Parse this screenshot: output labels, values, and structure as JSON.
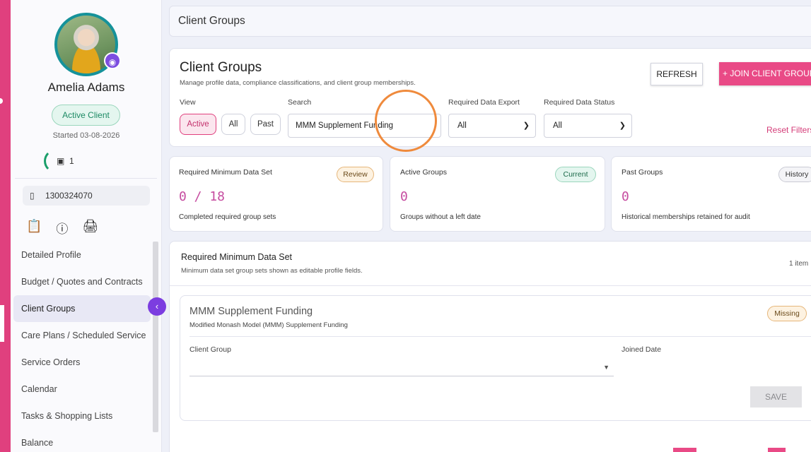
{
  "sidebar": {
    "client_name": "Amelia Adams",
    "status": "Active Client",
    "started": "Started 03-08-2026",
    "count": "1",
    "phone": "1300324070",
    "nav_items": [
      {
        "label": "Detailed Profile"
      },
      {
        "label": "Budget / Quotes and Contracts"
      },
      {
        "label": "Client Groups"
      },
      {
        "label": "Care Plans / Scheduled Service"
      },
      {
        "label": "Service Orders"
      },
      {
        "label": "Calendar"
      },
      {
        "label": "Tasks & Shopping Lists"
      },
      {
        "label": "Balance"
      }
    ],
    "selected_nav": "Client Groups"
  },
  "topbar": {
    "title": "Client Groups"
  },
  "header": {
    "title": "Client Groups",
    "subtitle": "Manage profile data, compliance classifications, and client group memberships.",
    "refresh_label": "REFRESH",
    "join_label": "+ JOIN CLIENT GROUP",
    "reset_label": "Reset Filters"
  },
  "filters": {
    "view_label": "View",
    "view_options": [
      "Active",
      "All",
      "Past"
    ],
    "view_selected": "Active",
    "search_label": "Search",
    "search_value": "MMM Supplement Funding",
    "export_label": "Required Data Export",
    "export_value": "All",
    "status_label": "Required Data Status",
    "status_value": "All"
  },
  "stats": [
    {
      "label": "Required Minimum Data Set",
      "badge": "Review",
      "value": "0 / 18",
      "desc": "Completed required group sets"
    },
    {
      "label": "Active Groups",
      "badge": "Current",
      "value": "0",
      "desc": "Groups without a left date"
    },
    {
      "label": "Past Groups",
      "badge": "History",
      "value": "0",
      "desc": "Historical memberships retained for audit"
    }
  ],
  "section": {
    "title": "Required Minimum Data Set",
    "subtitle": "Minimum data set group sets shown as editable profile fields.",
    "count": "1 item"
  },
  "group_card": {
    "title": "MMM Supplement Funding",
    "subtitle": "Modified Monash Model (MMM) Supplement Funding",
    "badge": "Missing",
    "client_group_label": "Client Group",
    "joined_date_label": "Joined Date",
    "save_label": "SAVE"
  }
}
